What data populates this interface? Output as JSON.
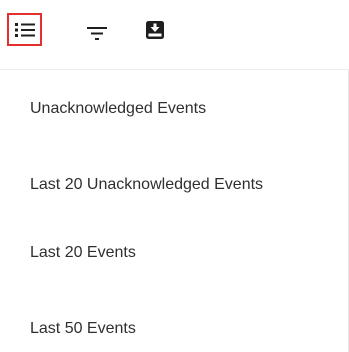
{
  "toolbar": {
    "tools": [
      {
        "icon": "list-icon",
        "selected": true
      },
      {
        "icon": "filter-icon",
        "selected": false
      },
      {
        "icon": "download-icon",
        "selected": false
      }
    ],
    "selected_border_color": "#e2302f",
    "icon_color": "#1f1f1f"
  },
  "menu": {
    "items": [
      {
        "label": "Unacknowledged Events"
      },
      {
        "label": "Last 20 Unacknowledged Events"
      },
      {
        "label": "Last 20 Events"
      },
      {
        "label": "Last 50 Events"
      }
    ]
  }
}
